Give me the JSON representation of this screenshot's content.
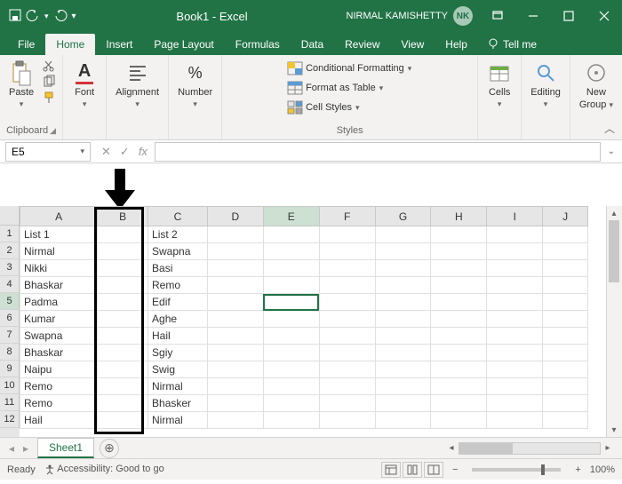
{
  "titlebar": {
    "doc_name": "Book1",
    "app_name": "Excel",
    "separator": " - ",
    "user_name": "NIRMAL KAMISHETTY",
    "user_initials": "NK"
  },
  "tabs": {
    "items": [
      "File",
      "Home",
      "Insert",
      "Page Layout",
      "Formulas",
      "Data",
      "Review",
      "View",
      "Help"
    ],
    "active": "Home",
    "tell_me": "Tell me"
  },
  "ribbon": {
    "clipboard": {
      "paste_label": "Paste",
      "group_label": "Clipboard"
    },
    "font": {
      "label": "Font"
    },
    "alignment": {
      "label": "Alignment"
    },
    "number": {
      "label": "Number"
    },
    "styles": {
      "cond_fmt": "Conditional Formatting",
      "fmt_table": "Format as Table",
      "cell_styles": "Cell Styles",
      "group_label": "Styles"
    },
    "cells": {
      "label": "Cells"
    },
    "editing": {
      "label": "Editing"
    },
    "newgroup": {
      "label": "New",
      "label2": "Group"
    }
  },
  "namebox": {
    "value": "E5"
  },
  "columns": [
    "A",
    "B",
    "C",
    "D",
    "E",
    "F",
    "G",
    "H",
    "I",
    "J"
  ],
  "rows": [
    {
      "n": 1,
      "A": "List 1",
      "C": "List 2"
    },
    {
      "n": 2,
      "A": "Nirmal",
      "C": "Swapna"
    },
    {
      "n": 3,
      "A": "Nikki",
      "C": "Basi"
    },
    {
      "n": 4,
      "A": "Bhaskar",
      "C": "Remo"
    },
    {
      "n": 5,
      "A": "Padma",
      "C": "Edif"
    },
    {
      "n": 6,
      "A": "Kumar",
      "C": "Aghe"
    },
    {
      "n": 7,
      "A": "Swapna",
      "C": "Hail"
    },
    {
      "n": 8,
      "A": "Bhaskar",
      "C": "Sgiy"
    },
    {
      "n": 9,
      "A": "Naipu",
      "C": "Swig"
    },
    {
      "n": 10,
      "A": "Remo",
      "C": "Nirmal"
    },
    {
      "n": 11,
      "A": "Remo",
      "C": "Bhasker"
    },
    {
      "n": 12,
      "A": "Hail",
      "C": "Nirmal"
    }
  ],
  "active_cell": {
    "row": 5,
    "col": "E"
  },
  "sheets": {
    "active": "Sheet1"
  },
  "status": {
    "ready": "Ready",
    "accessibility": "Accessibility: Good to go",
    "zoom": "100%"
  }
}
